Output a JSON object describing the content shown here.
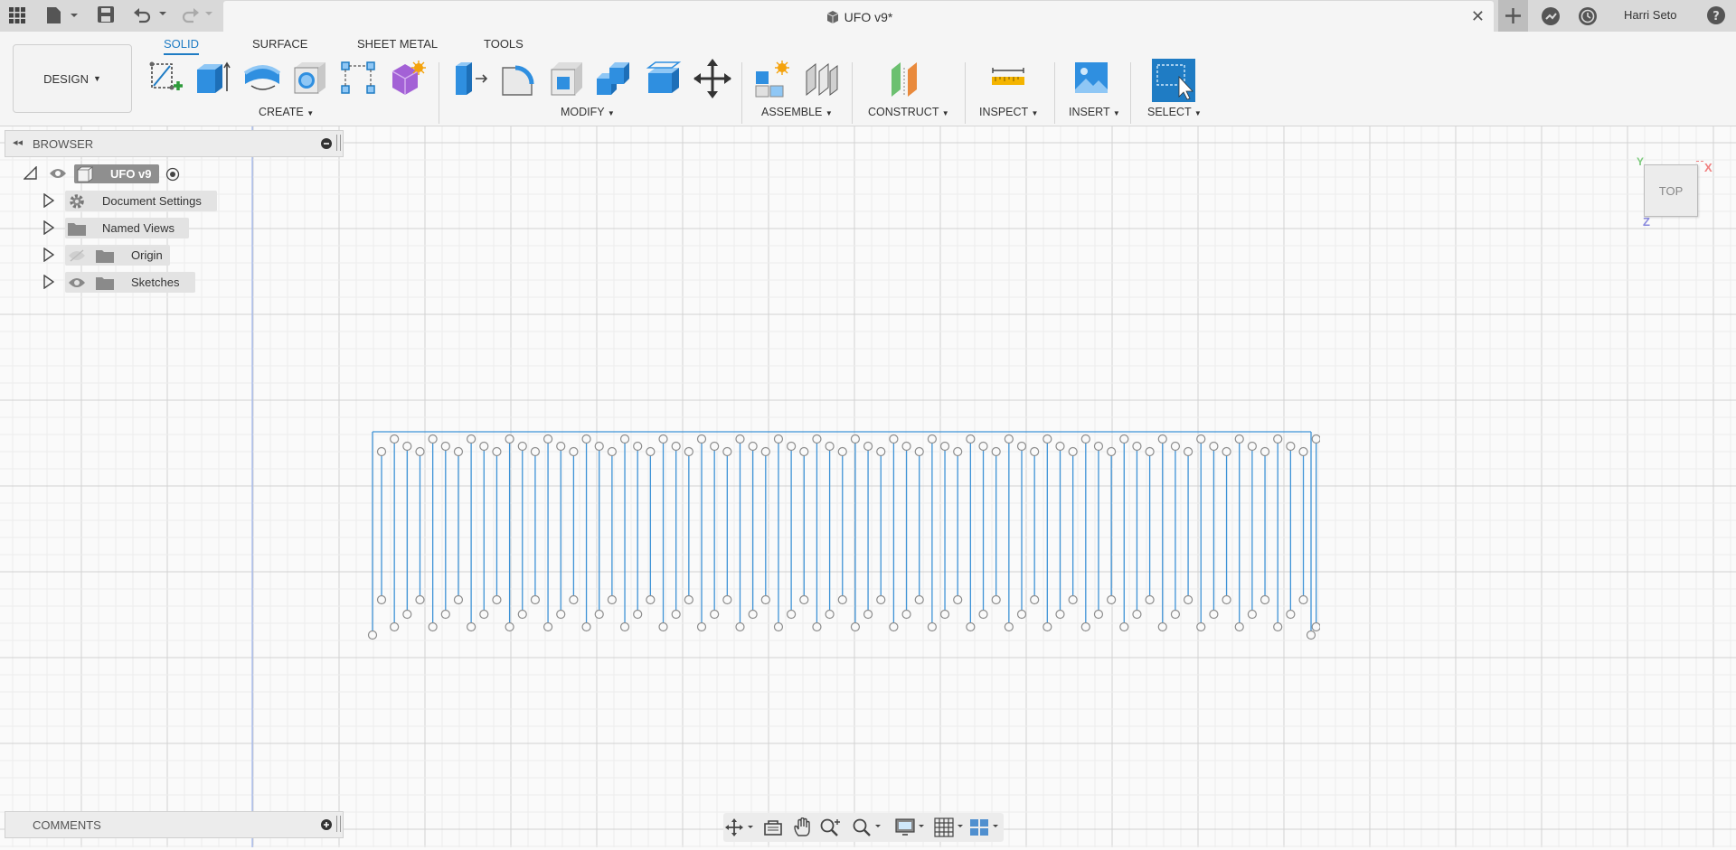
{
  "window": {
    "title": "UFO v9*",
    "user": "Harri Seto"
  },
  "ribbon": {
    "workspace": "DESIGN",
    "tabs": [
      "SOLID",
      "SURFACE",
      "SHEET METAL",
      "TOOLS"
    ],
    "groups": [
      "CREATE",
      "MODIFY",
      "ASSEMBLE",
      "CONSTRUCT",
      "INSPECT",
      "INSERT",
      "SELECT"
    ]
  },
  "browser": {
    "title": "BROWSER",
    "root": "UFO v9",
    "items": [
      "Document Settings",
      "Named Views",
      "Origin",
      "Sketches"
    ]
  },
  "comments": {
    "title": "COMMENTS"
  },
  "viewcube": {
    "face": "TOP",
    "axes": {
      "x": "X",
      "y": "Y",
      "z": "Z"
    }
  },
  "colors": {
    "accent": "#1f7cc4",
    "sketch_line": "#3f93d6",
    "sketch_point": "#8d8d8d",
    "grid": "#dedede"
  },
  "sketch": {
    "pin_columns": 74
  }
}
